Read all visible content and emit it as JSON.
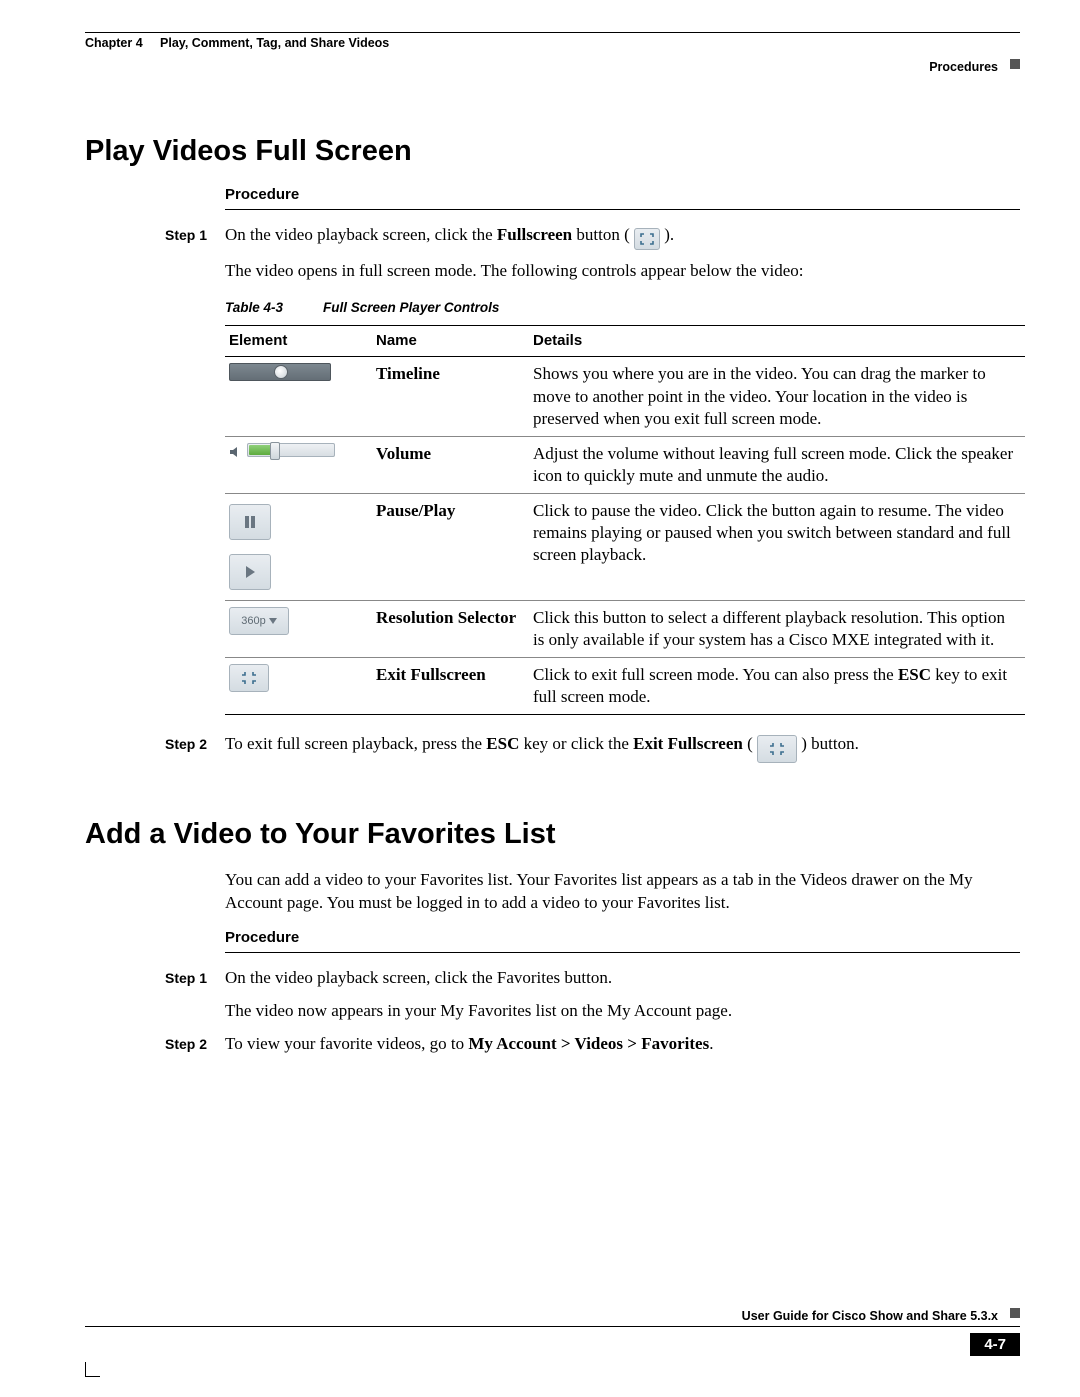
{
  "header": {
    "chapter_ref": "Chapter 4",
    "chapter_title": "Play, Comment, Tag, and Share Videos",
    "section_label": "Procedures"
  },
  "section1": {
    "heading": "Play Videos Full Screen",
    "procedure_label": "Procedure",
    "step1_label": "Step 1",
    "step1_text_a": "On the video playback screen, click the ",
    "step1_bold_a": "Fullscreen",
    "step1_text_b": " button (",
    "step1_text_c": ").",
    "step1_para2": "The video opens in full screen mode. The following controls appear below the video:",
    "table_caption_num": "Table 4-3",
    "table_caption_title": "Full Screen Player Controls",
    "table": {
      "col_element": "Element",
      "col_name": "Name",
      "col_details": "Details",
      "rows": [
        {
          "name": "Timeline",
          "name_bold": true,
          "details": "Shows you where you are in the video. You can drag the marker to move to another point in the video. Your location in the video is preserved when you exit full screen mode."
        },
        {
          "name": "Volume",
          "name_bold": true,
          "details": "Adjust the volume without leaving full screen mode. Click the speaker icon to quickly mute and unmute the audio."
        },
        {
          "name": "Pause/Play",
          "name_bold": true,
          "details": "Click to pause the video. Click the button again to resume. The video remains playing or paused when you switch between standard and full screen playback."
        },
        {
          "name": "Resolution Selector",
          "name_bold": false,
          "details": "Click this button to select a different playback resolution. This option is only available if your system has a Cisco MXE integrated with it.",
          "res_label": "360p"
        },
        {
          "name": "Exit Fullscreen",
          "name_bold": true,
          "details_a": "Click to exit full screen mode. You can also press the ",
          "details_bold": "ESC",
          "details_b": " key to exit full screen mode."
        }
      ]
    },
    "step2_label": "Step 2",
    "step2_text_a": "To exit full screen playback, press the ",
    "step2_bold_a": "ESC",
    "step2_text_b": " key or click the ",
    "step2_bold_b": "Exit Fullscreen",
    "step2_text_c": " (",
    "step2_text_d": ") button."
  },
  "section2": {
    "heading": "Add a Video to Your Favorites List",
    "intro": "You can add a video to your Favorites list. Your Favorites list appears as a tab in the Videos drawer on the My Account page. You must be logged in to add a video to your Favorites list.",
    "procedure_label": "Procedure",
    "step1_label": "Step 1",
    "step1_line1": "On the video playback screen, click the Favorites button.",
    "step1_line2": "The video now appears in your My Favorites list on the My Account page.",
    "step2_label": "Step 2",
    "step2_text_a": "To view your favorite videos, go to ",
    "step2_bold": "My Account > Videos > Favorites",
    "step2_text_b": "."
  },
  "footer": {
    "guide_title": "User Guide for Cisco Show and Share 5.3.x",
    "page_number": "4-7"
  }
}
